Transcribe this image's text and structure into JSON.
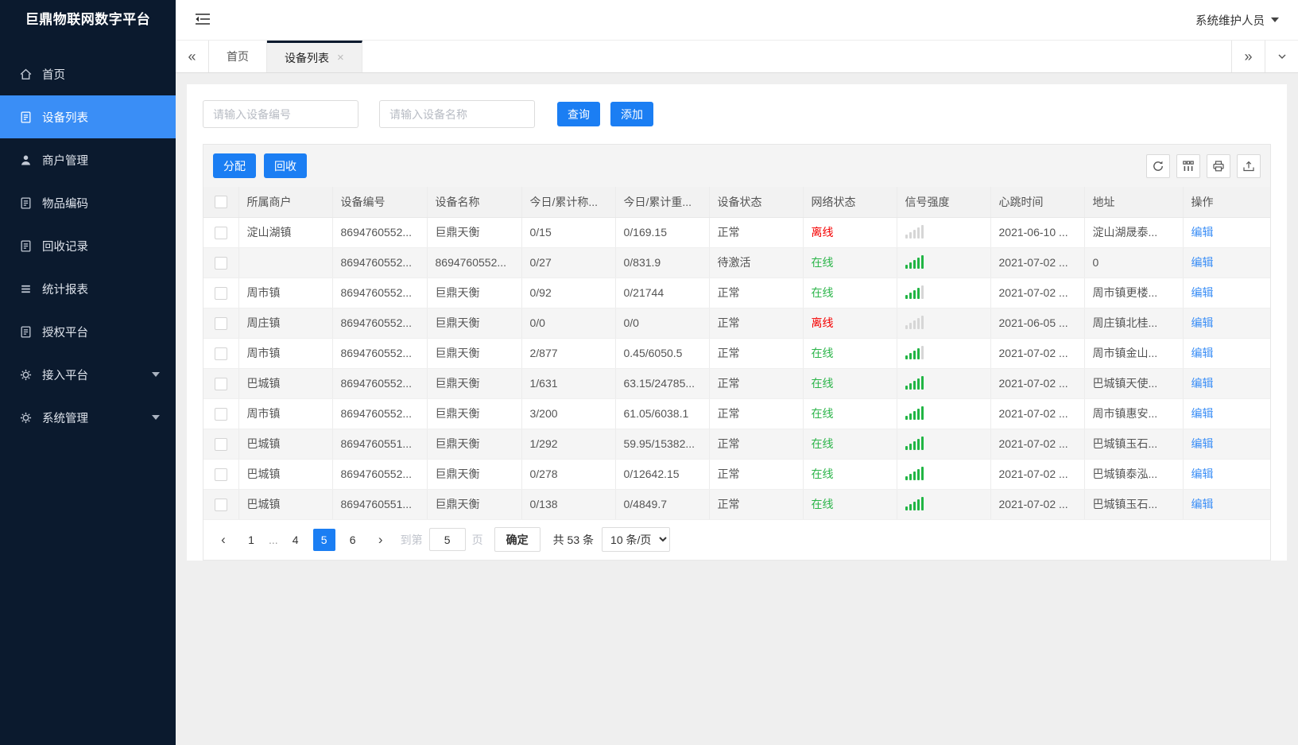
{
  "app": {
    "title": "巨鼎物联网数字平台",
    "user": "系统维护人员"
  },
  "sidebar": {
    "items": [
      {
        "key": "home",
        "label": "首页",
        "icon": "home-icon",
        "active": false,
        "expandable": false
      },
      {
        "key": "device-list",
        "label": "设备列表",
        "icon": "device-list-icon",
        "active": true,
        "expandable": false
      },
      {
        "key": "merchant-manage",
        "label": "商户管理",
        "icon": "merchant-icon",
        "active": false,
        "expandable": false
      },
      {
        "key": "item-code",
        "label": "物品编码",
        "icon": "item-code-icon",
        "active": false,
        "expandable": false
      },
      {
        "key": "recycle-record",
        "label": "回收记录",
        "icon": "recycle-record-icon",
        "active": false,
        "expandable": false
      },
      {
        "key": "report",
        "label": "统计报表",
        "icon": "report-icon",
        "active": false,
        "expandable": false
      },
      {
        "key": "auth-platform",
        "label": "授权平台",
        "icon": "auth-platform-icon",
        "active": false,
        "expandable": false
      },
      {
        "key": "access-platform",
        "label": "接入平台",
        "icon": "gear-icon",
        "active": false,
        "expandable": true
      },
      {
        "key": "system-manage",
        "label": "系统管理",
        "icon": "gear-icon",
        "active": false,
        "expandable": true
      }
    ]
  },
  "tabs": [
    {
      "key": "home",
      "label": "首页",
      "active": false,
      "closable": false
    },
    {
      "key": "device-list",
      "label": "设备列表",
      "active": true,
      "closable": true
    }
  ],
  "search": {
    "device_no_placeholder": "请输入设备编号",
    "device_name_placeholder": "请输入设备名称",
    "query_label": "查询",
    "add_label": "添加"
  },
  "toolbar": {
    "assign_label": "分配",
    "recycle_label": "回收"
  },
  "table": {
    "columns": [
      "所属商户",
      "设备编号",
      "设备名称",
      "今日/累计称...",
      "今日/累计重...",
      "设备状态",
      "网络状态",
      "信号强度",
      "心跳时间",
      "地址",
      "操作"
    ],
    "edit_label": "编辑",
    "rows": [
      {
        "merchant": "淀山湖镇",
        "device_no": "8694760552...",
        "device_name": "巨鼎天衡",
        "today_count": "0/15",
        "today_weight": "0/169.15",
        "status": "正常",
        "network": "离线",
        "online": false,
        "signal": 0,
        "heartbeat": "2021-06-10 ...",
        "address": "淀山湖晟泰..."
      },
      {
        "merchant": "",
        "device_no": "8694760552...",
        "device_name": "8694760552...",
        "today_count": "0/27",
        "today_weight": "0/831.9",
        "status": "待激活",
        "network": "在线",
        "online": true,
        "signal": 5,
        "heartbeat": "2021-07-02 ...",
        "address": "0"
      },
      {
        "merchant": "周市镇",
        "device_no": "8694760552...",
        "device_name": "巨鼎天衡",
        "today_count": "0/92",
        "today_weight": "0/21744",
        "status": "正常",
        "network": "在线",
        "online": true,
        "signal": 4,
        "heartbeat": "2021-07-02 ...",
        "address": "周市镇更楼..."
      },
      {
        "merchant": "周庄镇",
        "device_no": "8694760552...",
        "device_name": "巨鼎天衡",
        "today_count": "0/0",
        "today_weight": "0/0",
        "status": "正常",
        "network": "离线",
        "online": false,
        "signal": 0,
        "heartbeat": "2021-06-05 ...",
        "address": "周庄镇北桂..."
      },
      {
        "merchant": "周市镇",
        "device_no": "8694760552...",
        "device_name": "巨鼎天衡",
        "today_count": "2/877",
        "today_weight": "0.45/6050.5",
        "status": "正常",
        "network": "在线",
        "online": true,
        "signal": 4,
        "heartbeat": "2021-07-02 ...",
        "address": "周市镇金山..."
      },
      {
        "merchant": "巴城镇",
        "device_no": "8694760552...",
        "device_name": "巨鼎天衡",
        "today_count": "1/631",
        "today_weight": "63.15/24785...",
        "status": "正常",
        "network": "在线",
        "online": true,
        "signal": 5,
        "heartbeat": "2021-07-02 ...",
        "address": "巴城镇天使..."
      },
      {
        "merchant": "周市镇",
        "device_no": "8694760552...",
        "device_name": "巨鼎天衡",
        "today_count": "3/200",
        "today_weight": "61.05/6038.1",
        "status": "正常",
        "network": "在线",
        "online": true,
        "signal": 5,
        "heartbeat": "2021-07-02 ...",
        "address": "周市镇惠安..."
      },
      {
        "merchant": "巴城镇",
        "device_no": "8694760551...",
        "device_name": "巨鼎天衡",
        "today_count": "1/292",
        "today_weight": "59.95/15382...",
        "status": "正常",
        "network": "在线",
        "online": true,
        "signal": 5,
        "heartbeat": "2021-07-02 ...",
        "address": "巴城镇玉石..."
      },
      {
        "merchant": "巴城镇",
        "device_no": "8694760552...",
        "device_name": "巨鼎天衡",
        "today_count": "0/278",
        "today_weight": "0/12642.15",
        "status": "正常",
        "network": "在线",
        "online": true,
        "signal": 5,
        "heartbeat": "2021-07-02 ...",
        "address": "巴城镇泰泓..."
      },
      {
        "merchant": "巴城镇",
        "device_no": "8694760551...",
        "device_name": "巨鼎天衡",
        "today_count": "0/138",
        "today_weight": "0/4849.7",
        "status": "正常",
        "network": "在线",
        "online": true,
        "signal": 5,
        "heartbeat": "2021-07-02 ...",
        "address": "巴城镇玉石..."
      }
    ]
  },
  "pagination": {
    "pages": [
      "1",
      "...",
      "4",
      "5",
      "6"
    ],
    "current": "5",
    "goto_label": "到第",
    "goto_value": "5",
    "page_label": "页",
    "confirm_label": "确定",
    "total_label": "共 53 条",
    "page_size": "10 条/页"
  },
  "colors": {
    "sidebar_bg": "#0b1a2e",
    "accent_blue": "#1b7ef3",
    "active_item_blue": "#3a8ef6",
    "online_green": "#2cb54a",
    "offline_red": "#f50000"
  }
}
